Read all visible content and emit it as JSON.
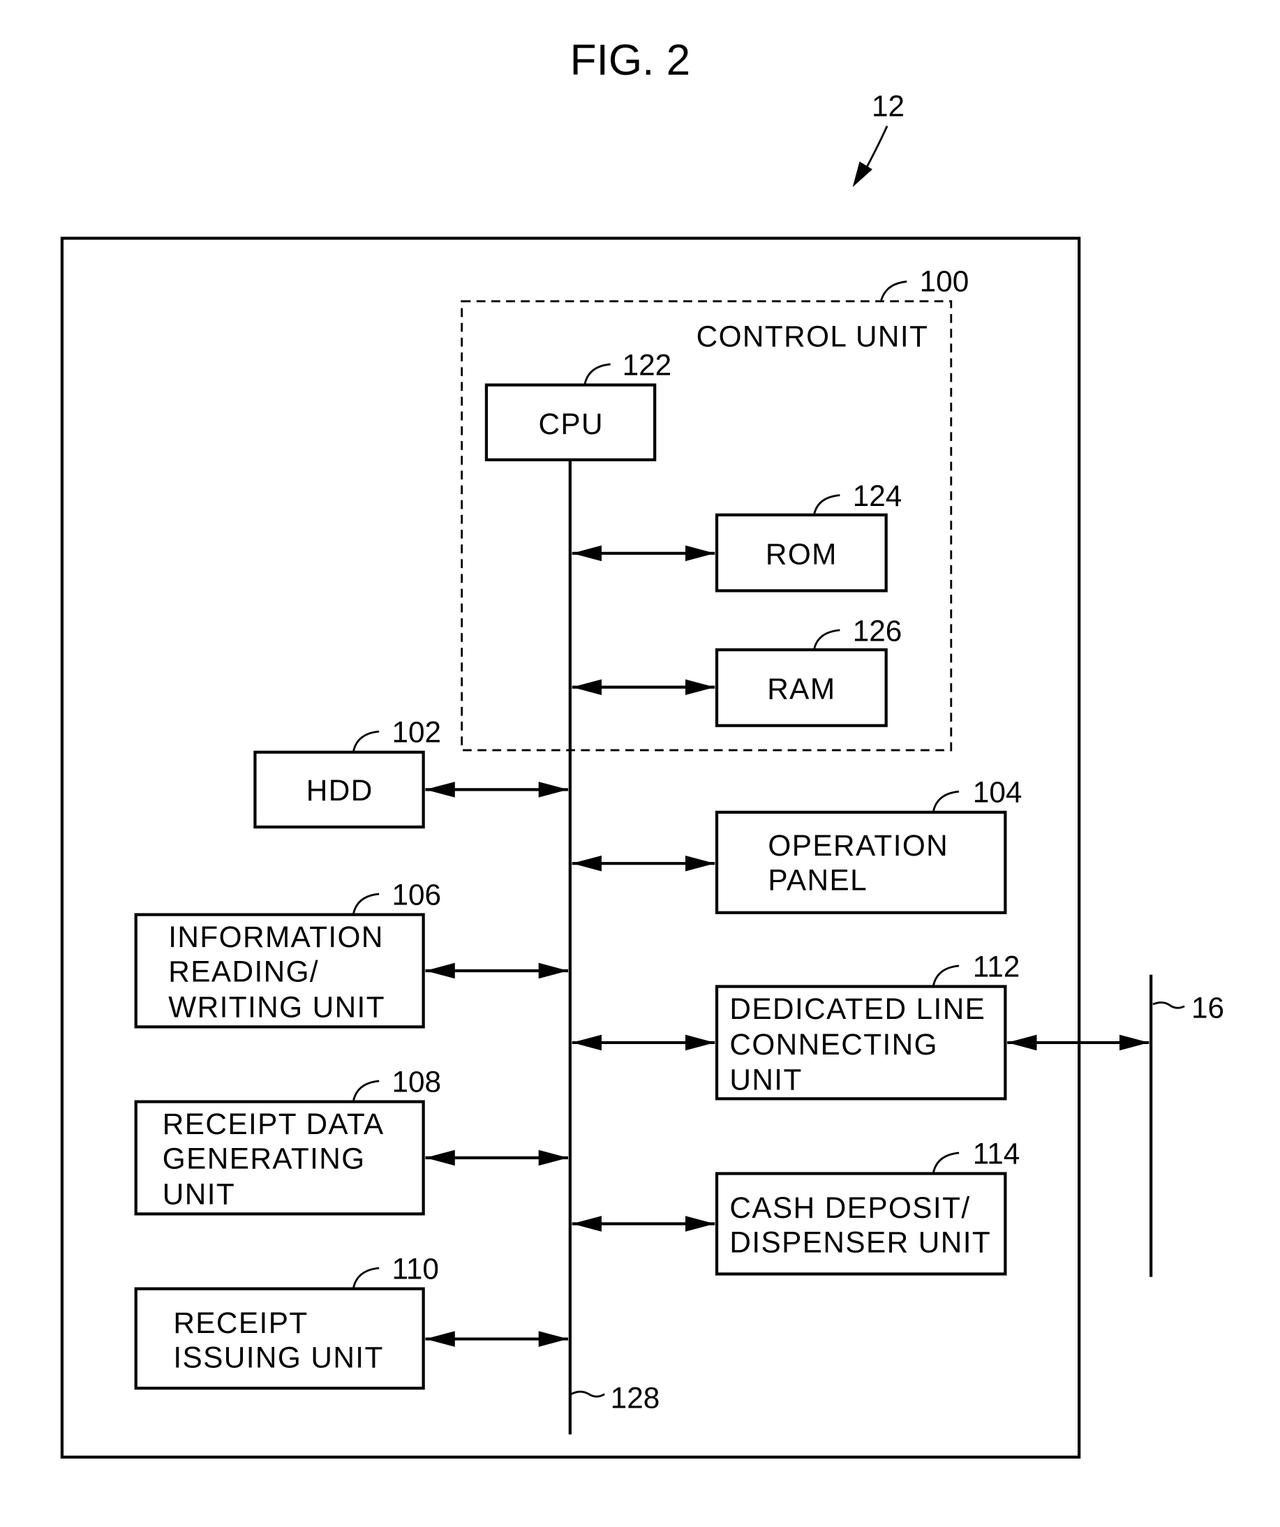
{
  "figure": {
    "title": "FIG. 2",
    "device_ref": "12",
    "bus_ref": "128",
    "network_ref": "16"
  },
  "control_unit": {
    "label": "CONTROL UNIT",
    "ref": "100"
  },
  "blocks": {
    "cpu": {
      "lines": [
        "CPU"
      ],
      "ref": "122"
    },
    "rom": {
      "lines": [
        "ROM"
      ],
      "ref": "124"
    },
    "ram": {
      "lines": [
        "RAM"
      ],
      "ref": "126"
    },
    "hdd": {
      "lines": [
        "HDD"
      ],
      "ref": "102"
    },
    "operation_panel": {
      "lines": [
        "OPERATION",
        "PANEL"
      ],
      "ref": "104"
    },
    "info_rw": {
      "lines": [
        "INFORMATION",
        "READING/",
        "WRITING UNIT"
      ],
      "ref": "106"
    },
    "dedicated_line": {
      "lines": [
        "DEDICATED LINE",
        "CONNECTING",
        "UNIT"
      ],
      "ref": "112"
    },
    "receipt_data": {
      "lines": [
        "RECEIPT DATA",
        "GENERATING",
        "UNIT"
      ],
      "ref": "108"
    },
    "cash": {
      "lines": [
        "CASH DEPOSIT/",
        "DISPENSER UNIT"
      ],
      "ref": "114"
    },
    "receipt_issuing": {
      "lines": [
        "RECEIPT",
        "ISSUING UNIT"
      ],
      "ref": "110"
    }
  }
}
